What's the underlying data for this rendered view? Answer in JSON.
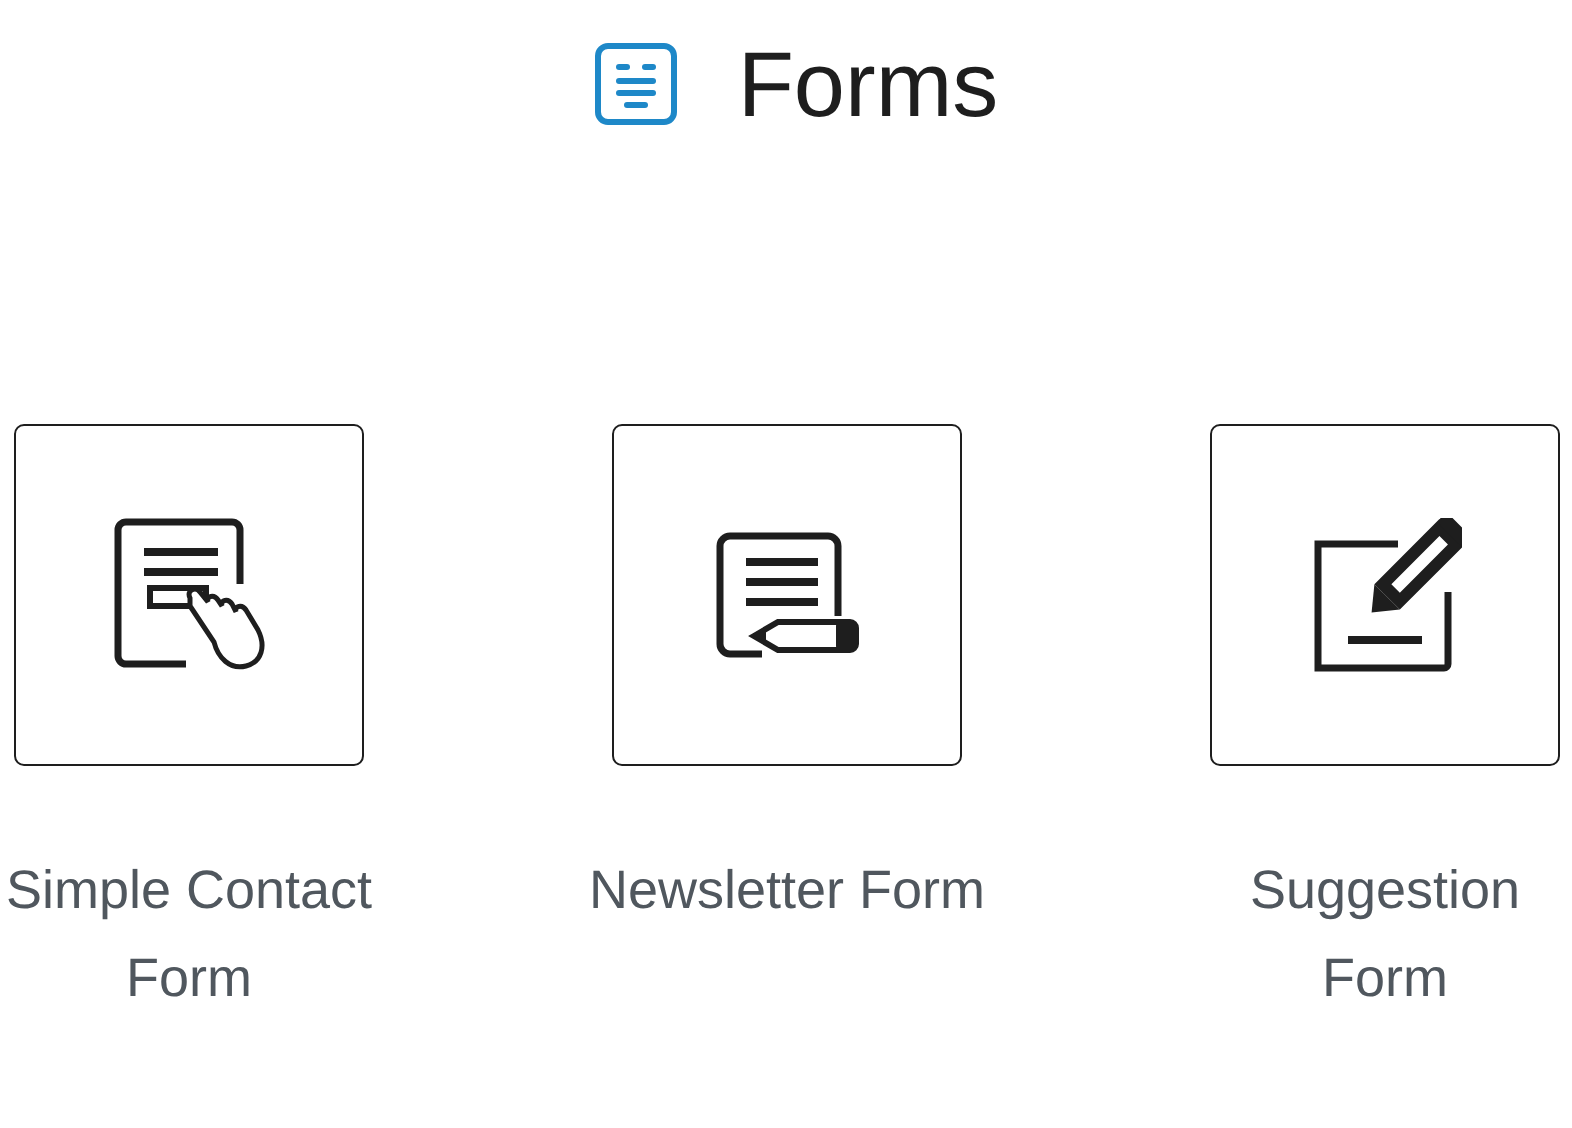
{
  "heading": {
    "title": "Forms"
  },
  "items": [
    {
      "kind": "contact",
      "label": "Simple Contact Form"
    },
    {
      "kind": "newsletter",
      "label": "Newsletter Form"
    },
    {
      "kind": "suggestion",
      "label": "Suggestion Form"
    }
  ]
}
